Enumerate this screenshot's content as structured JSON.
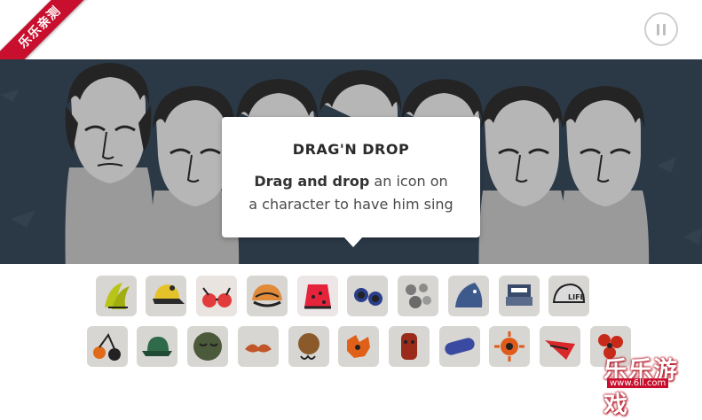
{
  "badge": {
    "text": "乐乐亲测"
  },
  "pause": {
    "icon": "pause-icon"
  },
  "dialog": {
    "title": "DRAG'N DROP",
    "line_bold": "Drag and drop",
    "line_rest": " an icon on",
    "line2": "a character to have him sing"
  },
  "watermark": {
    "big": "乐乐游戏",
    "small": "www.6ll.com"
  },
  "icons_row1": [
    "bananas-icon",
    "yellow-cap-icon",
    "red-glasses-icon",
    "orange-hat-icon",
    "red-fez-icon",
    "blue-goggles-icon",
    "grey-bubbles-icon",
    "fish-mask-icon",
    "robot-mask-icon",
    "life-helmet-icon"
  ],
  "icons_row2": [
    "orange-cherries-icon",
    "green-hat-icon",
    "sleepy-face-icon",
    "mustache-icon",
    "brown-curls-icon",
    "orange-splat-icon",
    "red-totem-icon",
    "blue-tube-icon",
    "orange-sun-icon",
    "red-wing-icon",
    "red-flower-icon"
  ],
  "colors": {
    "stage": "#2b3947",
    "ribbon": "#c8102e",
    "tile": "#d8d6d2"
  }
}
